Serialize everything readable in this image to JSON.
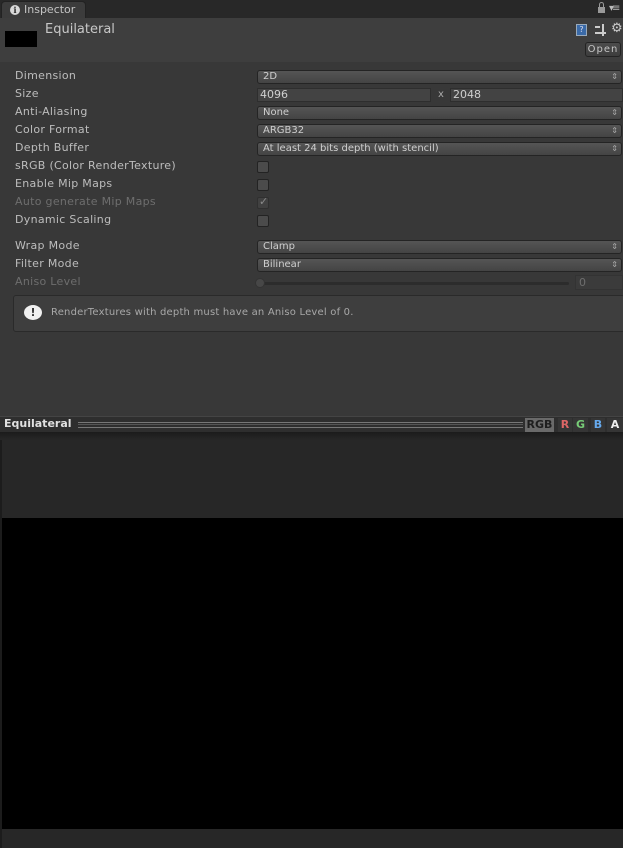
{
  "tab": {
    "icon": "info-icon",
    "label": "Inspector"
  },
  "window_controls": {
    "lock": "lock-icon",
    "menu": "menu-icon"
  },
  "header": {
    "title": "Equilateral",
    "thumbnail_color": "#000000",
    "icons": [
      "help-book-icon",
      "preset-sliders-icon",
      "gear-icon"
    ],
    "open_label": "Open"
  },
  "properties": {
    "dimension": {
      "label": "Dimension",
      "value": "2D"
    },
    "size": {
      "label": "Size",
      "width": "4096",
      "separator": "x",
      "height": "2048"
    },
    "anti_aliasing": {
      "label": "Anti-Aliasing",
      "value": "None"
    },
    "color_format": {
      "label": "Color Format",
      "value": "ARGB32"
    },
    "depth_buffer": {
      "label": "Depth Buffer",
      "value": "At least 24 bits depth (with stencil)"
    },
    "srgb": {
      "label": "sRGB (Color RenderTexture)",
      "checked": false
    },
    "enable_mip_maps": {
      "label": "Enable Mip Maps",
      "checked": false
    },
    "auto_generate_mip_maps": {
      "label": "Auto generate Mip Maps",
      "checked": true,
      "disabled": true
    },
    "dynamic_scaling": {
      "label": "Dynamic Scaling",
      "checked": false
    },
    "wrap_mode": {
      "label": "Wrap Mode",
      "value": "Clamp"
    },
    "filter_mode": {
      "label": "Filter Mode",
      "value": "Bilinear"
    },
    "aniso_level": {
      "label": "Aniso Level",
      "value": "0",
      "slider_fraction": 0,
      "disabled": true
    }
  },
  "helpbox": {
    "icon": "warning-icon",
    "text": "RenderTextures with depth must have an Aniso Level of 0."
  },
  "preview": {
    "title": "Equilateral",
    "channels": [
      "RGB",
      "R",
      "G",
      "B",
      "A"
    ],
    "active_channel": "RGB"
  },
  "glyphs": {
    "dropdown_arrows": "⇕",
    "check": "✓",
    "info": "i",
    "help": "?",
    "gear": "⚙",
    "warning": "!",
    "menu": "▾≡"
  }
}
